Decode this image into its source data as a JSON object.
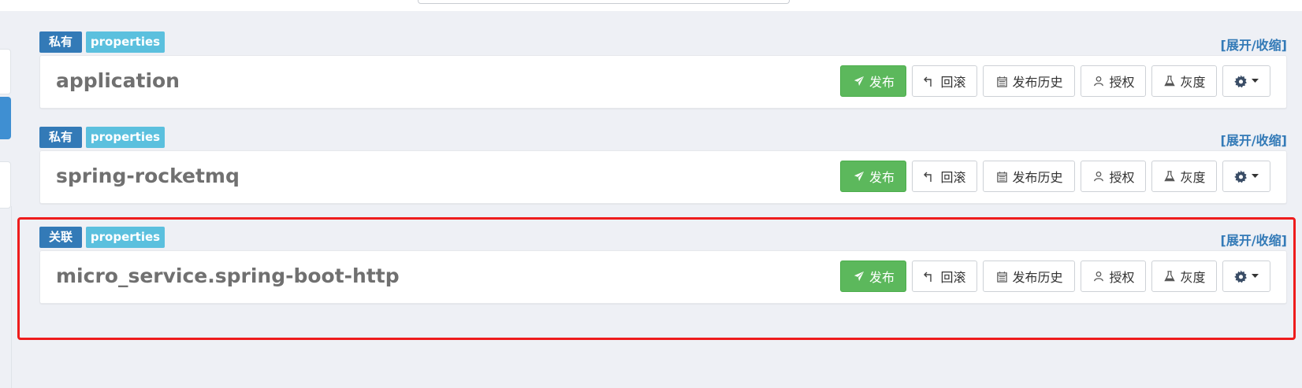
{
  "namespaces": [
    {
      "type_badge": "私有",
      "format_badge": "properties",
      "toggle": "[展开/收缩]",
      "name": "application",
      "highlighted": false
    },
    {
      "type_badge": "私有",
      "format_badge": "properties",
      "toggle": "[展开/收缩]",
      "name": "spring-rocketmq",
      "highlighted": false
    },
    {
      "type_badge": "关联",
      "format_badge": "properties",
      "toggle": "[展开/收缩]",
      "name": "micro_service.spring-boot-http",
      "highlighted": true
    }
  ],
  "buttons": {
    "publish": "发布",
    "rollback": "回滚",
    "history": "发布历史",
    "auth": "授权",
    "gray": "灰度"
  },
  "icons": {
    "publish": "paper-plane-icon",
    "rollback": "undo-icon",
    "history": "calendar-icon",
    "auth": "user-icon",
    "gray": "flask-icon",
    "settings": "gear-icon",
    "caret": "caret-down-icon"
  },
  "colors": {
    "type_badge_bg": "#337ab7",
    "format_badge_bg": "#5bc0de",
    "publish_bg": "#5cb85c",
    "highlight_border": "#ee1c1c",
    "toggle_text": "#337ab7"
  }
}
